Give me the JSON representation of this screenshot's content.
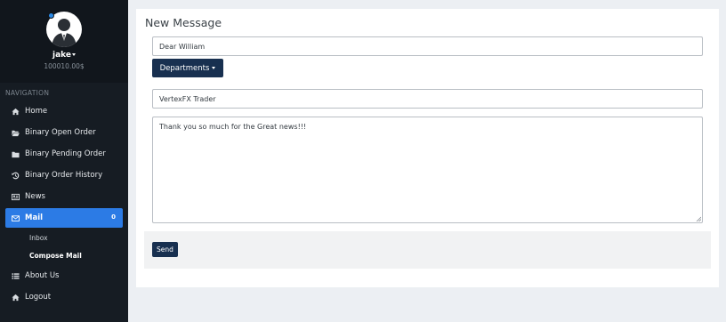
{
  "profile": {
    "username": "jake",
    "balance": "100010.00$"
  },
  "nav": {
    "heading": "NAVIGATION",
    "items": [
      {
        "label": "Home",
        "icon": "home-icon"
      },
      {
        "label": "Binary Open Order",
        "icon": "folder-open-icon"
      },
      {
        "label": "Binary Pending Order",
        "icon": "folder-icon"
      },
      {
        "label": "Binary Order History",
        "icon": "history-icon"
      },
      {
        "label": "News",
        "icon": "newspaper-icon"
      },
      {
        "label": "Mail",
        "icon": "envelope-icon",
        "badge": "0"
      },
      {
        "label": "About Us",
        "icon": "list-icon"
      },
      {
        "label": "Logout",
        "icon": "home-icon"
      }
    ],
    "mail_sub": [
      {
        "label": "Inbox"
      },
      {
        "label": "Compose Mail"
      }
    ]
  },
  "compose": {
    "title": "New Message",
    "to_value": "Dear William",
    "departments_label": "Departments",
    "subject_value": "VertexFX Trader",
    "body_value": "Thank you so much for the Great news!!!",
    "send_label": "Send"
  },
  "colors": {
    "sidebar": "#161c23",
    "active": "#2c7be5",
    "button": "#183050"
  }
}
